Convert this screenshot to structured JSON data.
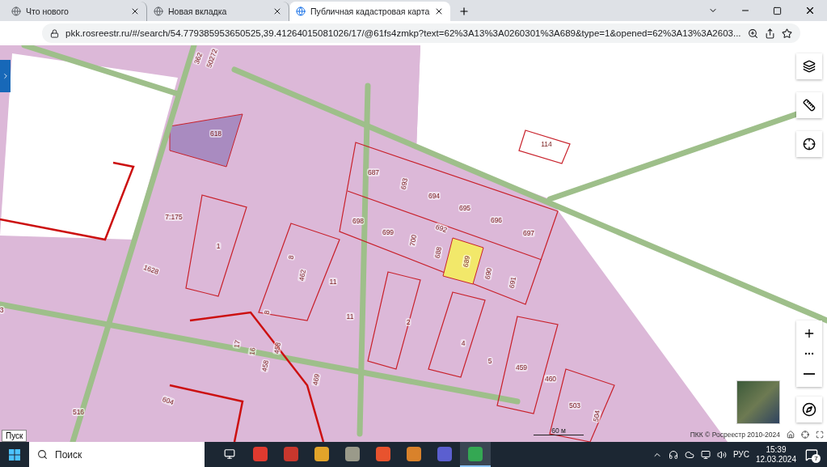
{
  "tabs": [
    {
      "title": "Что нового",
      "selected": false
    },
    {
      "title": "Новая вкладка",
      "selected": false
    },
    {
      "title": "Публичная кадастровая карта",
      "selected": true
    }
  ],
  "address": "pkk.rosreestr.ru/#/search/54.779385953650525,39.41264015081026/17/@61fs4zmkp?text=62%3A13%3A0260301%3A689&type=1&opened=62%3A13%3A2603...",
  "map": {
    "labels": [
      "362",
      "50272",
      "618",
      "7:175",
      "687",
      "693",
      "694",
      "695",
      "696",
      "697",
      "698",
      "699",
      "700",
      "692",
      "688",
      "689",
      "690",
      "691",
      "114",
      "1",
      "1628",
      "8",
      "462",
      "11",
      "11",
      "8",
      "2",
      "4",
      "5",
      "459",
      "460",
      "503",
      "504",
      "17",
      "16",
      "458",
      "458",
      "469",
      "604",
      "516",
      "3"
    ],
    "scale": "60 м",
    "attribution": "ПКК © Росреестр 2010-2024",
    "tooltip": "Пуск"
  },
  "taskbar": {
    "search_placeholder": "Поиск",
    "apps": [
      {
        "color": "#e03a2f",
        "selected": false
      },
      {
        "color": "#c8372d",
        "selected": false
      },
      {
        "color": "#e2a42a",
        "selected": false
      },
      {
        "color": "#9a9a8a",
        "selected": false
      },
      {
        "color": "#e8532e",
        "selected": false
      },
      {
        "color": "#d9822b",
        "selected": false
      },
      {
        "color": "#5b5fd0",
        "selected": false
      },
      {
        "color": "#34a853",
        "selected": true
      }
    ],
    "language": "РУС",
    "time": "15:39",
    "date": "12.03.2024",
    "notifications": "7"
  }
}
